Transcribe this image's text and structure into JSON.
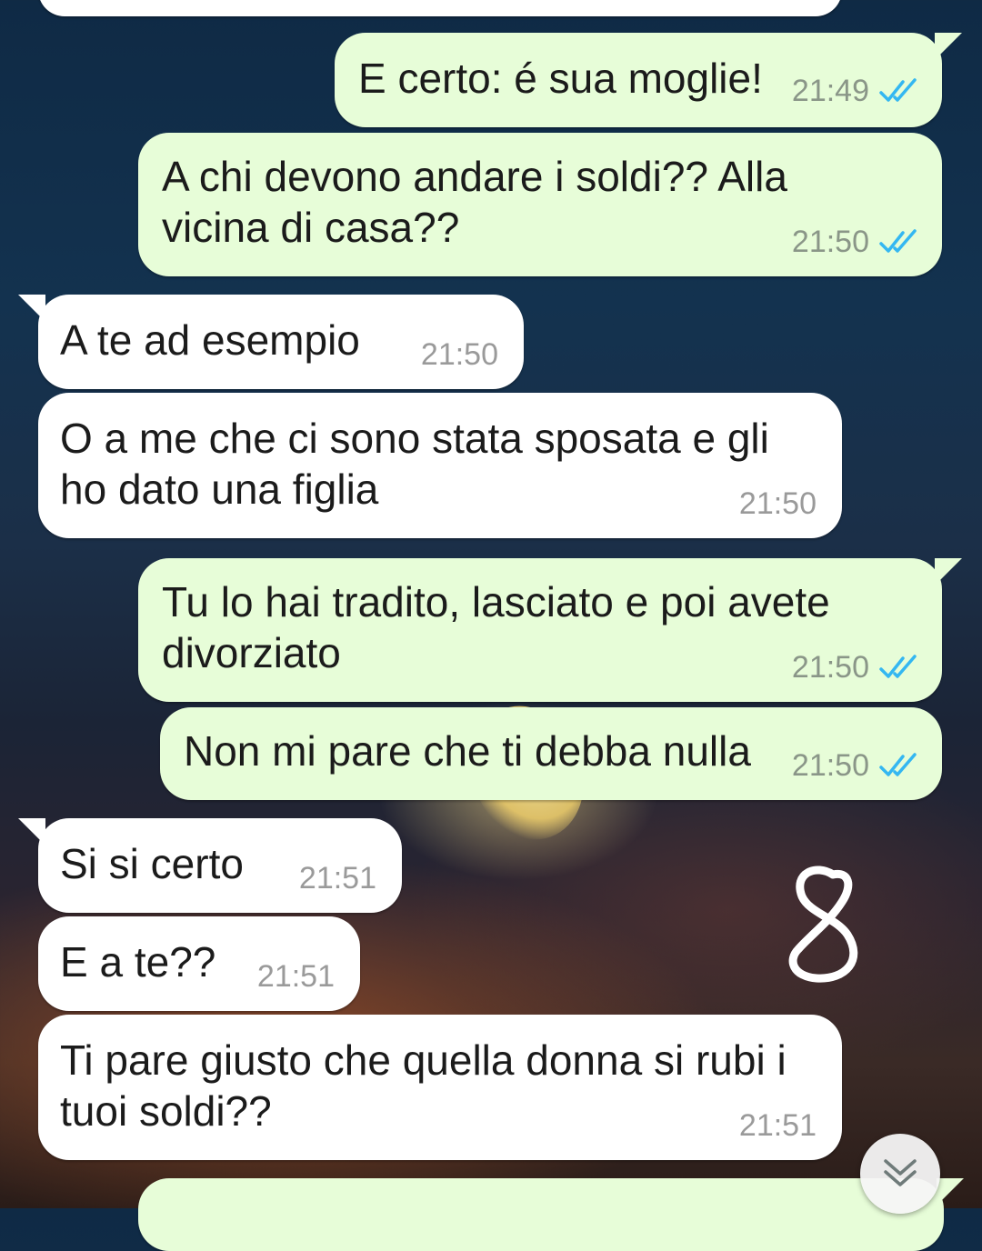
{
  "chat": {
    "messages": [
      {
        "direction": "outgoing",
        "lines": [
          "E certo: é sua moglie!"
        ],
        "time": "21:49",
        "status": "read"
      },
      {
        "direction": "outgoing",
        "lines": [
          "A chi devono andare i soldi?? Alla",
          "vicina di casa??"
        ],
        "time": "21:50",
        "status": "read"
      },
      {
        "direction": "incoming",
        "lines": [
          "A te ad esempio"
        ],
        "time": "21:50"
      },
      {
        "direction": "incoming",
        "lines": [
          "O a me che ci sono stata sposata e gli",
          "ho dato una figlia"
        ],
        "time": "21:50"
      },
      {
        "direction": "outgoing",
        "lines": [
          "Tu lo hai tradito, lasciato e poi avete",
          "divorziato"
        ],
        "time": "21:50",
        "status": "read"
      },
      {
        "direction": "outgoing",
        "lines": [
          "Non mi pare che ti debba nulla"
        ],
        "time": "21:50",
        "status": "read"
      },
      {
        "direction": "incoming",
        "lines": [
          "Si si certo"
        ],
        "time": "21:51"
      },
      {
        "direction": "incoming",
        "lines": [
          "E a te??"
        ],
        "time": "21:51"
      },
      {
        "direction": "incoming",
        "lines": [
          "Ti pare giusto che quella donna si rubi i",
          "tuoi soldi??"
        ],
        "time": "21:51"
      }
    ]
  },
  "annotation": {
    "text": "8"
  },
  "colors": {
    "outgoing_bubble": "#e7fdd8",
    "incoming_bubble": "#ffffff",
    "read_ticks": "#34b7f1",
    "timestamp": "#8a9688"
  },
  "icons": {
    "read_status": "double-check-icon",
    "scroll_down": "double-chevron-down-icon"
  }
}
